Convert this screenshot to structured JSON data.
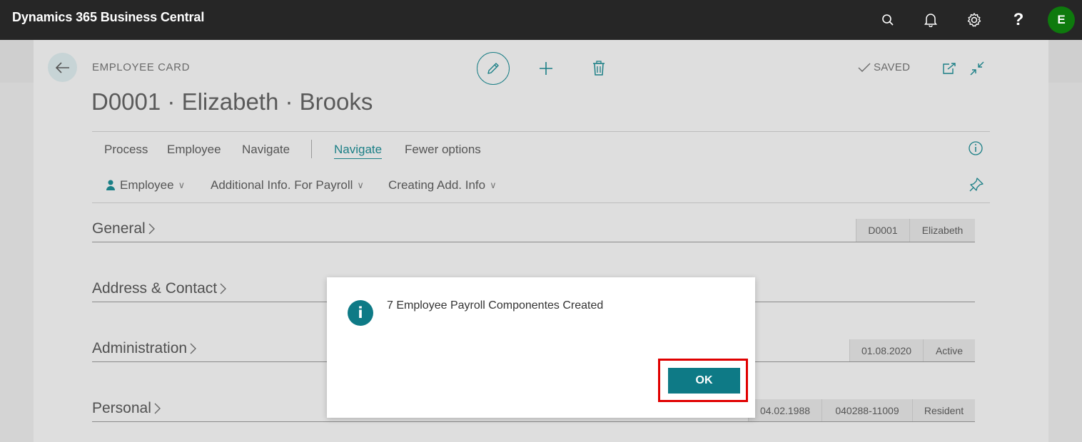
{
  "app": {
    "title": "Dynamics 365 Business Central",
    "user_initial": "E"
  },
  "card": {
    "kind": "EMPLOYEE CARD",
    "title": "D0001 · Elizabeth · Brooks",
    "saved_label": "SAVED"
  },
  "menu": {
    "items": [
      "Process",
      "Employee",
      "Navigate"
    ],
    "active": "Navigate",
    "fewer": "Fewer options"
  },
  "actions": {
    "items": [
      "Employee",
      "Additional Info. For Payroll",
      "Creating Add. Info"
    ]
  },
  "sections": [
    {
      "title": "General",
      "chips": [
        "D0001",
        "Elizabeth"
      ]
    },
    {
      "title": "Address & Contact",
      "chips": []
    },
    {
      "title": "Administration",
      "chips": [
        "01.08.2020",
        "Active"
      ]
    },
    {
      "title": "Personal",
      "chips": [
        "04.02.1988",
        "040288-11009",
        "Resident"
      ]
    }
  ],
  "dialog": {
    "message": "7 Employee Payroll Componentes Created",
    "ok_label": "OK"
  },
  "colors": {
    "accent": "#0e7a86",
    "topbar": "#262626",
    "highlight": "#e00000",
    "avatar": "#0e7a0d"
  }
}
